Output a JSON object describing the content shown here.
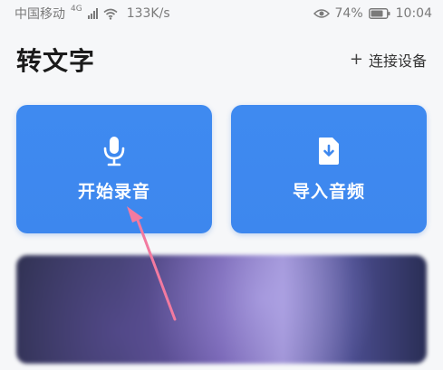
{
  "status_bar": {
    "carrier": "中国移动",
    "network_tag": "4G",
    "speed": "133K/s",
    "battery_percent": "74%",
    "time": "10:04"
  },
  "header": {
    "title": "转文字",
    "connect_label": "连接设备",
    "connect_icon": "plus-icon"
  },
  "cards": [
    {
      "label": "开始录音",
      "icon": "microphone-icon"
    },
    {
      "label": "导入音频",
      "icon": "import-file-icon"
    }
  ],
  "colors": {
    "card_blue": "#3d87ee",
    "title_text": "#1b1b1b",
    "annotation_arrow": "#f27aa0"
  }
}
